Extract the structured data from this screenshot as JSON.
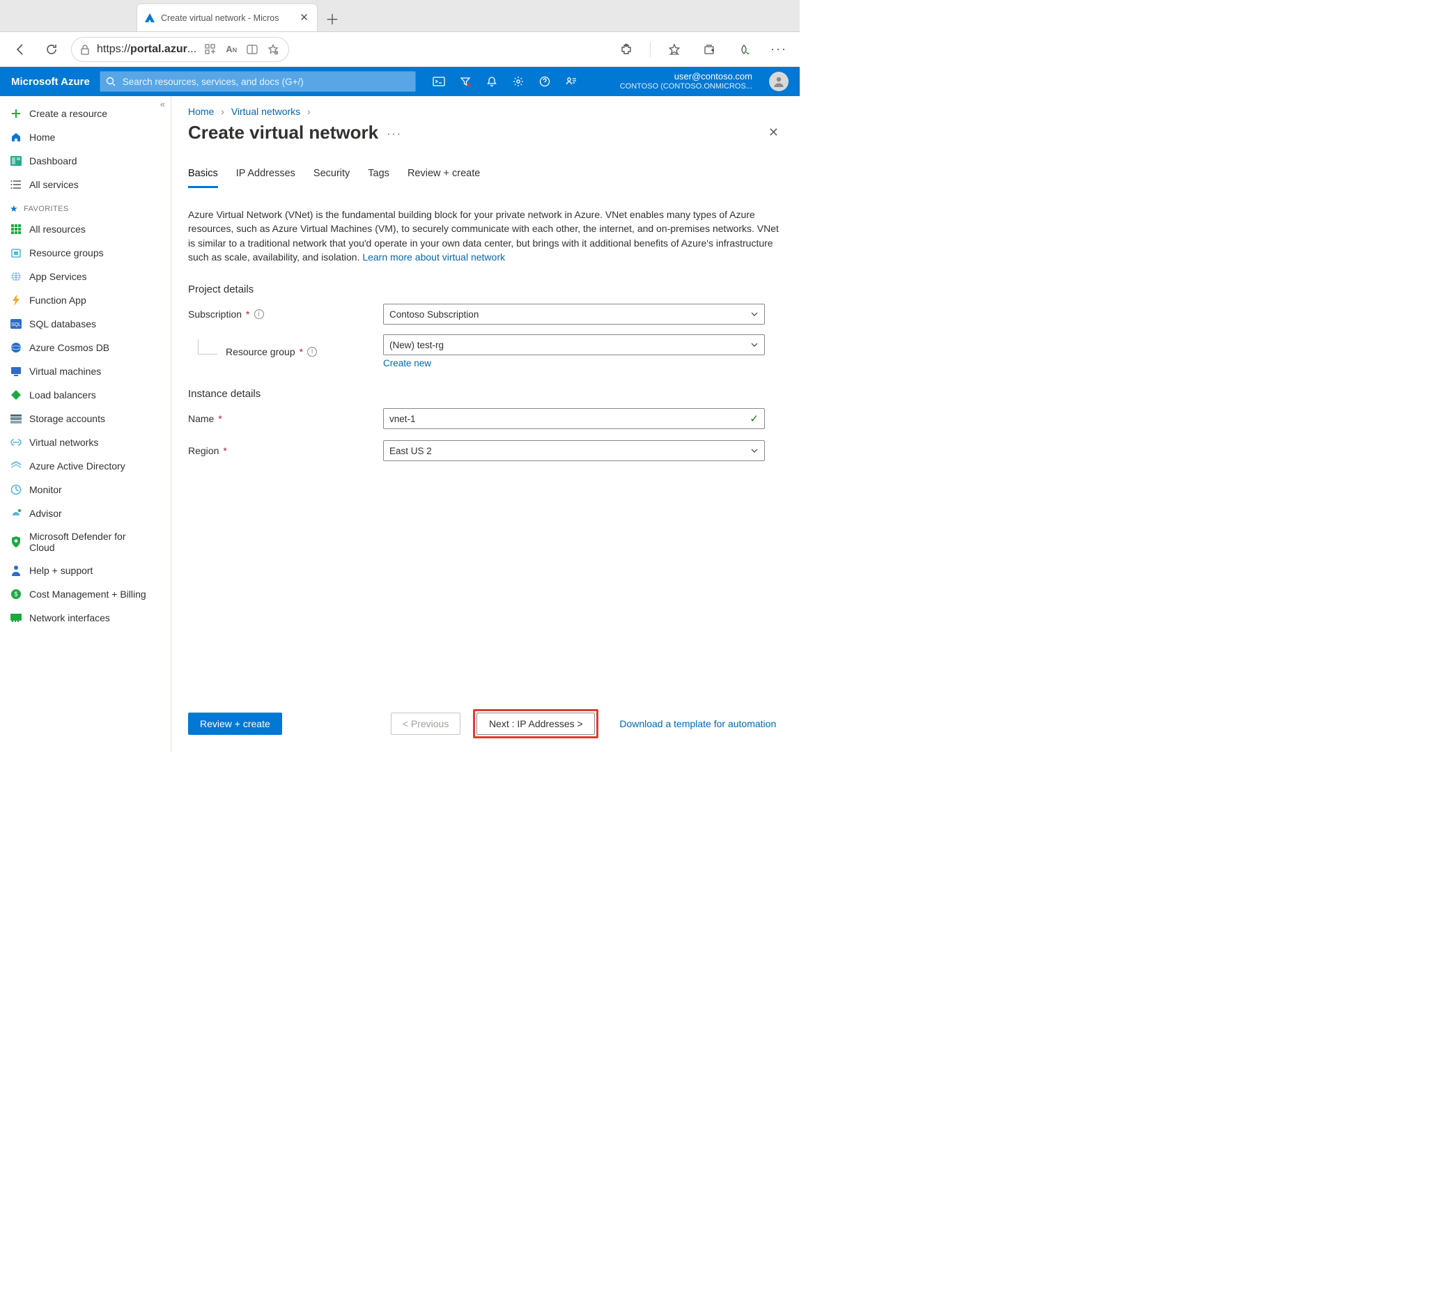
{
  "browser": {
    "tab_title": "Create virtual network - Micros",
    "url_display_prefix": "https://",
    "url_display_bold": "portal.azur",
    "url_display_suffix": "..."
  },
  "header": {
    "brand": "Microsoft Azure",
    "search_placeholder": "Search resources, services, and docs (G+/)",
    "user_email": "user@contoso.com",
    "tenant": "CONTOSO (CONTOSO.ONMICROS..."
  },
  "sidebar": {
    "create": "Create a resource",
    "home": "Home",
    "dashboard": "Dashboard",
    "all_services": "All services",
    "favorites_label": "FAVORITES",
    "items": [
      "All resources",
      "Resource groups",
      "App Services",
      "Function App",
      "SQL databases",
      "Azure Cosmos DB",
      "Virtual machines",
      "Load balancers",
      "Storage accounts",
      "Virtual networks",
      "Azure Active Directory",
      "Monitor",
      "Advisor",
      "Microsoft Defender for Cloud",
      "Help + support",
      "Cost Management + Billing",
      "Network interfaces"
    ]
  },
  "breadcrumbs": {
    "home": "Home",
    "vnets": "Virtual networks"
  },
  "page": {
    "title": "Create virtual network"
  },
  "tabs": {
    "basics": "Basics",
    "ip": "IP Addresses",
    "security": "Security",
    "tags": "Tags",
    "review": "Review + create"
  },
  "intro": {
    "text": "Azure Virtual Network (VNet) is the fundamental building block for your private network in Azure. VNet enables many types of Azure resources, such as Azure Virtual Machines (VM), to securely communicate with each other, the internet, and on-premises networks. VNet is similar to a traditional network that you'd operate in your own data center, but brings with it additional benefits of Azure's infrastructure such as scale, availability, and isolation.   ",
    "link": "Learn more about virtual network"
  },
  "sections": {
    "project": "Project details",
    "instance": "Instance details"
  },
  "form": {
    "subscription_label": "Subscription",
    "subscription_value": "Contoso Subscription",
    "rg_label": "Resource group",
    "rg_value": "(New) test-rg",
    "rg_create_new": "Create new",
    "name_label": "Name",
    "name_value": "vnet-1",
    "region_label": "Region",
    "region_value": "East US 2"
  },
  "footer": {
    "review": "Review + create",
    "previous": "< Previous",
    "next": "Next : IP Addresses >",
    "download": "Download a template for automation"
  }
}
